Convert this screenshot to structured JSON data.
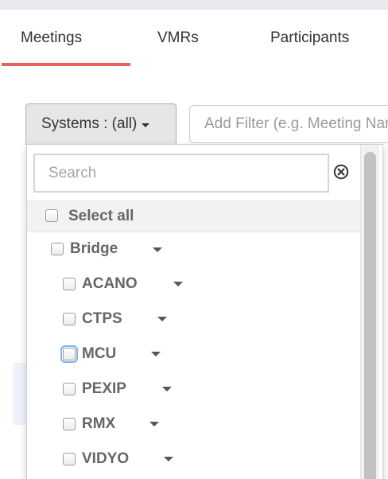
{
  "tabs": {
    "meetings": "Meetings",
    "vmrs": "VMRs",
    "participants": "Participants"
  },
  "systems_button": {
    "label": "Systems : (all)"
  },
  "filter": {
    "placeholder": "Add Filter (e.g. Meeting Name)"
  },
  "dropdown": {
    "search_placeholder": "Search",
    "select_all": "Select all",
    "parent_item": "Bridge",
    "child_items": [
      "ACANO",
      "CTPS",
      "MCU",
      "PEXIP",
      "RMX",
      "VIDYO"
    ],
    "focused_item": "MCU"
  },
  "colors": {
    "accent_underline": "#e8635c",
    "focus_ring": "#7eb0f2"
  },
  "icons": {
    "clear": "circle-x-icon",
    "expand": "caret-down-icon"
  }
}
